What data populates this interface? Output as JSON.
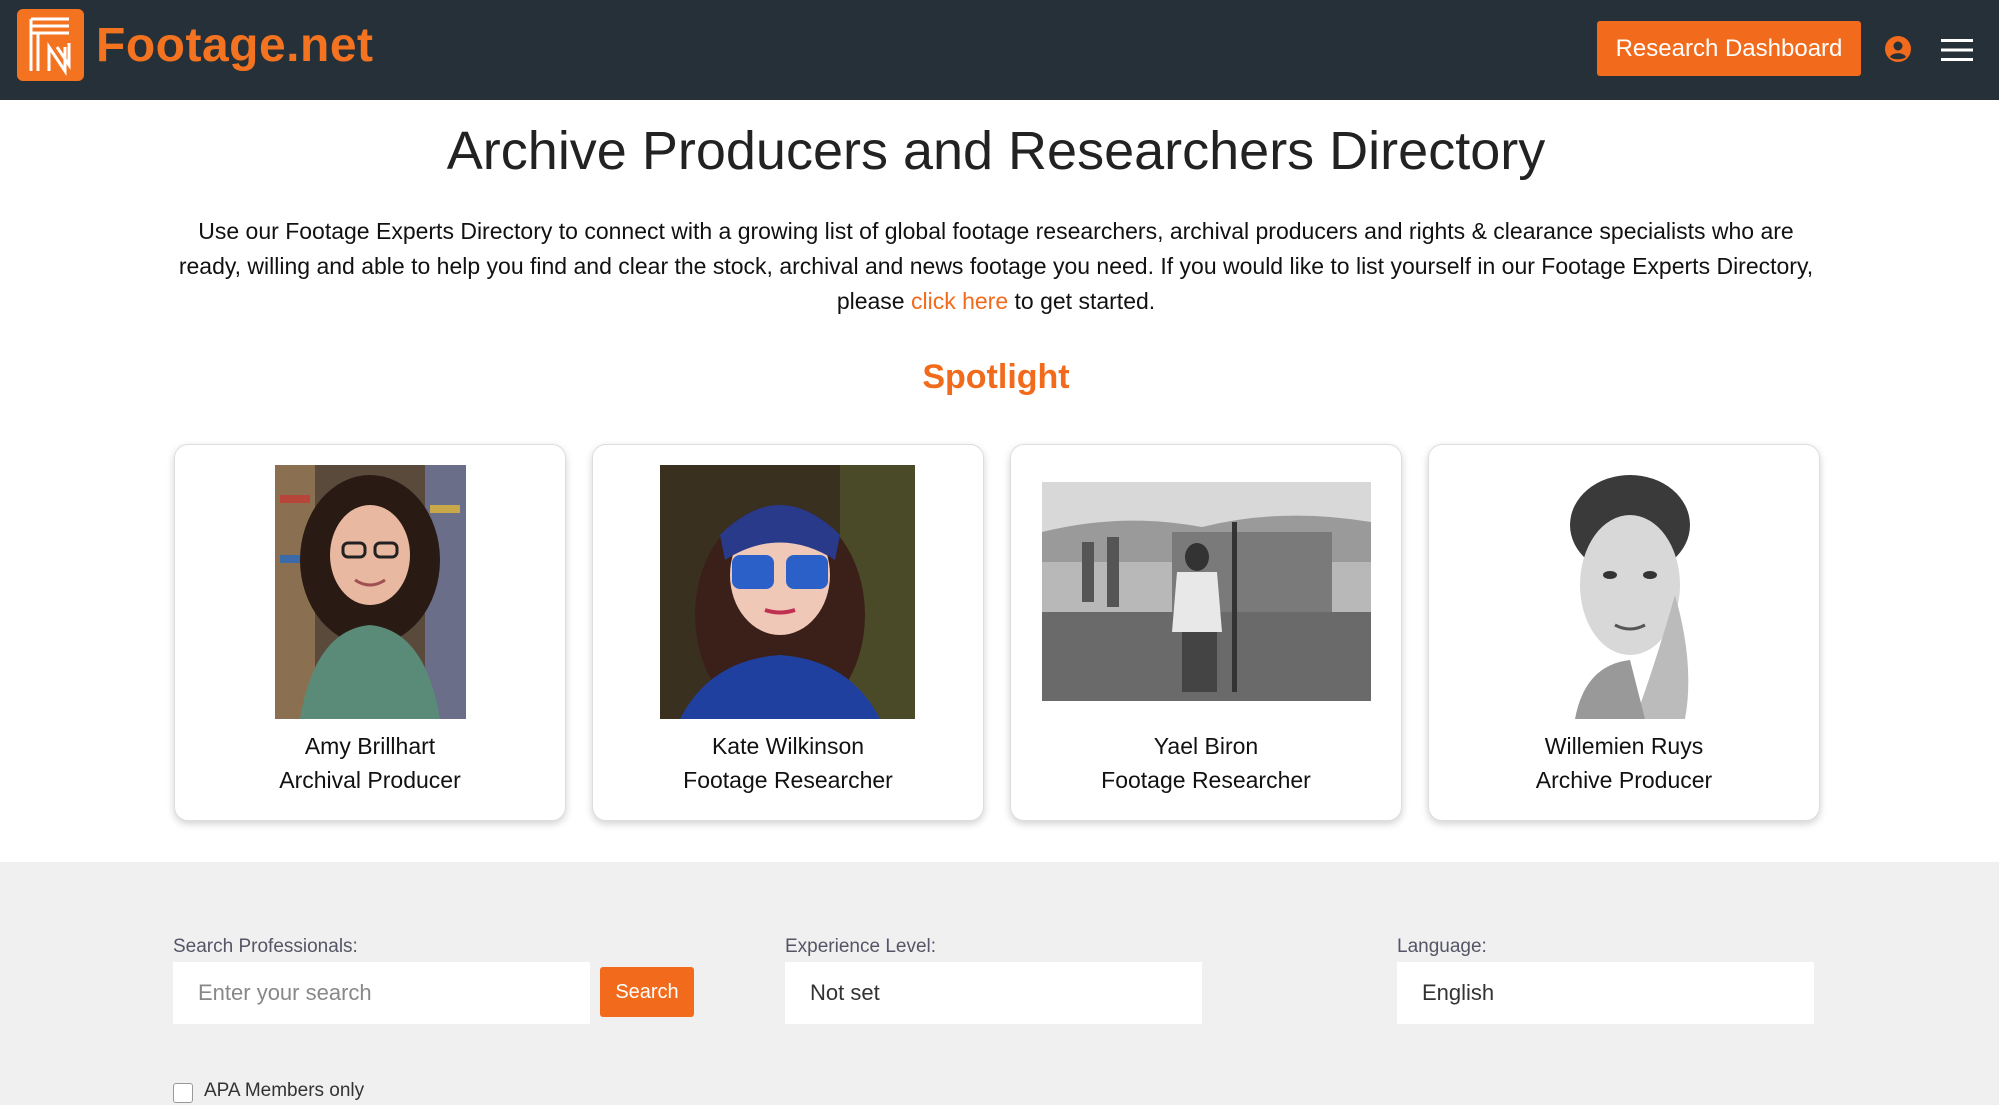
{
  "header": {
    "logo_text": "Footage.net",
    "dashboard_label": "Research Dashboard"
  },
  "main": {
    "title": "Archive Producers and Researchers Directory",
    "intro_text": "Use our Footage Experts Directory to connect with a growing list of global footage researchers, archival producers and rights & clearance specialists who are ready, willing and able to help you find and clear the stock, archival and news footage you need. If you would like to list yourself in our Footage Experts Directory, please ",
    "intro_link": "click here",
    "intro_suffix": " to get started.",
    "spotlight_title": "Spotlight"
  },
  "spotlight": [
    {
      "name": "Amy Brillhart",
      "role": "Archival Producer"
    },
    {
      "name": "Kate Wilkinson",
      "role": "Footage Researcher"
    },
    {
      "name": "Yael Biron",
      "role": "Footage Researcher"
    },
    {
      "name": "Willemien Ruys",
      "role": "Archive Producer"
    }
  ],
  "filters": {
    "search_label": "Search Professionals:",
    "search_placeholder": "Enter your search",
    "search_button": "Search",
    "experience_label": "Experience Level:",
    "experience_value": "Not set",
    "language_label": "Language:",
    "language_value": "English",
    "apa_label": "APA Members only"
  },
  "colors": {
    "accent": "#f26a1b",
    "header_bg": "#263038",
    "filter_bg": "#f0f0f0"
  }
}
